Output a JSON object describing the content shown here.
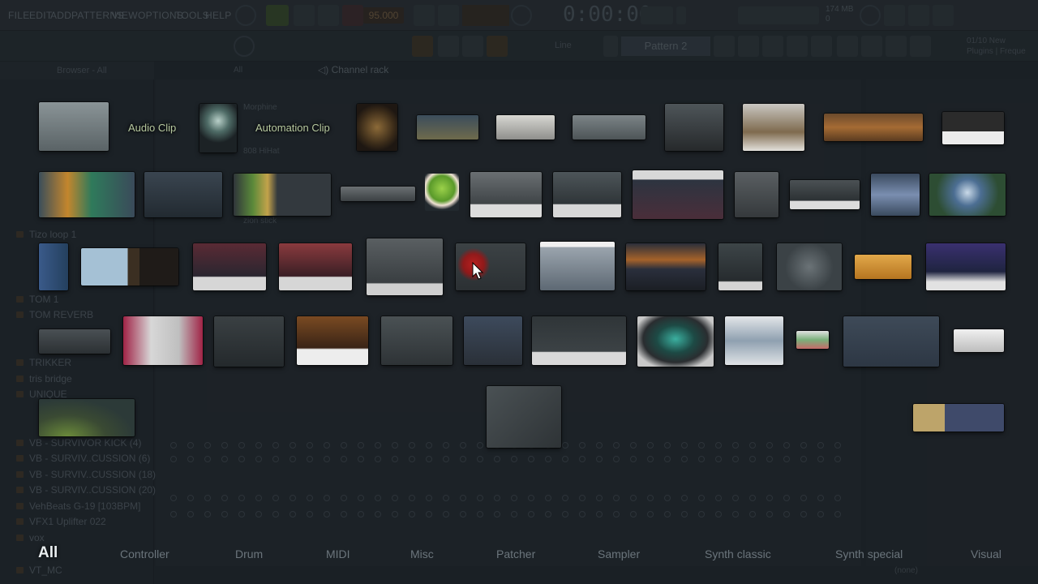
{
  "menu": [
    "FILE",
    "EDIT",
    "ADD",
    "PATTERNS",
    "VIEW",
    "OPTIONS",
    "TOOLS",
    "HELP"
  ],
  "transport": {
    "time": "0:00:00",
    "bpm": "95.000",
    "pattern": "Pattern 2",
    "snap_mode": "Line",
    "cpu_line1": "174 MB",
    "cpu_line2": "0",
    "hint_line1": "01/10 New",
    "hint_line2": "Plugins | Freque"
  },
  "browser": {
    "header": "Browser - All",
    "items": [
      "Tizo loop 1",
      "TOM 1",
      "TOM REVERB",
      "TRIKKER",
      "tris bridge",
      "UNIQUE",
      "VB - SURVIVOR KICK (4)",
      "VB - SURVIV..CUSSION (6)",
      "VB - SURVIV..CUSSION (18)",
      "VB - SURVIV..CUSSION (20)",
      "VehBeats G-19 [103BPM]",
      "VFX1 Uplifter 022",
      "vox",
      "VT_MC"
    ]
  },
  "channel_rack": {
    "title": "Channel rack",
    "filter": "All",
    "channels": [
      "Morphine",
      "808 HiHat",
      "zion stick"
    ]
  },
  "mixer": {
    "insert_route": "(none)"
  },
  "plugin_picker": {
    "clip_labels": [
      "Audio Clip",
      "Automation Clip"
    ],
    "categories": [
      "All",
      "Controller",
      "Drum",
      "MIDI",
      "Misc",
      "Patcher",
      "Sampler",
      "Synth classic",
      "Synth special",
      "Visual"
    ],
    "active_category": "All"
  }
}
